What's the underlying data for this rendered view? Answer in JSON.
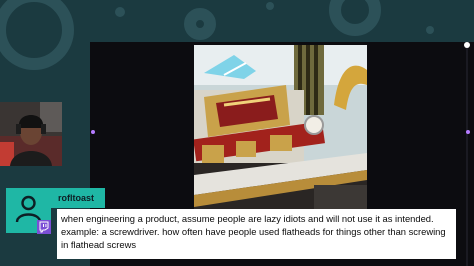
{
  "overlay": {
    "accent_color": "#1fb7a5",
    "platform_badge_color": "#7b4fd6",
    "background_color": "#1b3a40"
  },
  "webcam": {
    "icon": "streamer-webcam-feed"
  },
  "shared_media": {
    "icon": "photo-of-ornate-toy-vehicle"
  },
  "chat": {
    "username": "rofltoast",
    "avatar_icon": "default-user-icon",
    "platform_icon": "twitch-icon",
    "message": "when engineering a product, assume people are lazy idiots and will not use it as intended. example: a screwdriver. how often have people used flatheads for things other than screwing in flathead screws"
  }
}
